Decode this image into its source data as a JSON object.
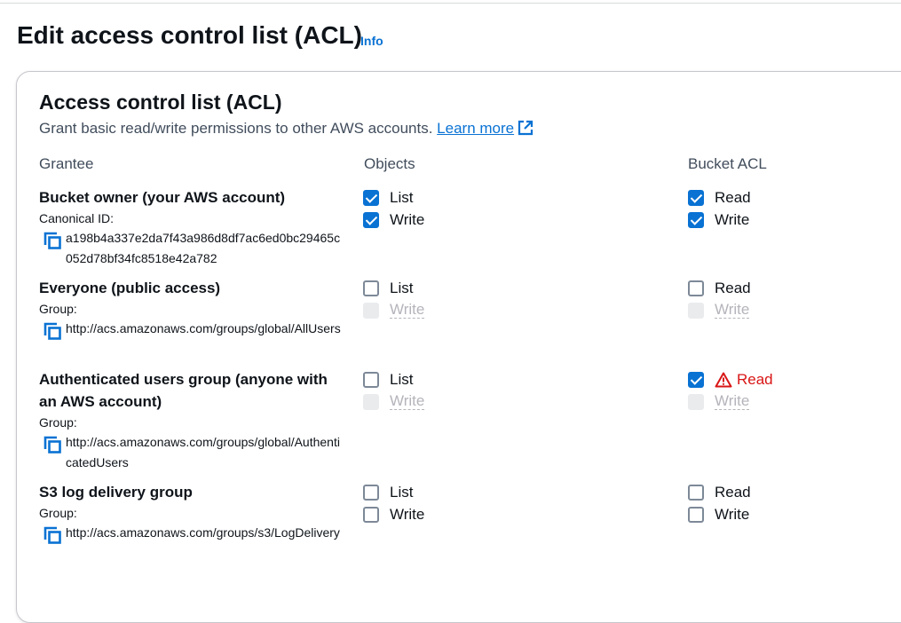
{
  "header": {
    "title": "Edit access control list (ACL)",
    "info": "Info"
  },
  "acl": {
    "title": "Access control list (ACL)",
    "description": "Grant basic read/write permissions to other AWS accounts. ",
    "learn_more": "Learn more",
    "columns": {
      "grantee": "Grantee",
      "objects": "Objects",
      "bucket": "Bucket ACL"
    }
  },
  "grantees": [
    {
      "name": "Bucket owner (your AWS account)",
      "id_label": "Canonical ID:",
      "id_value": "a198b4a337e2da7f43a986d8df7ac6ed0bc29465c052d78bf34fc8518e42a782",
      "objects": [
        {
          "label": "List",
          "state": "checked"
        },
        {
          "label": "Write",
          "state": "checked"
        }
      ],
      "bucket": [
        {
          "label": "Read",
          "state": "checked"
        },
        {
          "label": "Write",
          "state": "checked"
        }
      ]
    },
    {
      "name": "Everyone (public access)",
      "id_label": "Group:",
      "id_value": "http://acs.amazonaws.com/groups/global/AllUsers",
      "objects": [
        {
          "label": "List",
          "state": "unchecked"
        },
        {
          "label": "Write",
          "state": "disabled"
        }
      ],
      "bucket": [
        {
          "label": "Read",
          "state": "unchecked"
        },
        {
          "label": "Write",
          "state": "disabled"
        }
      ]
    },
    {
      "name": "Authenticated users group (anyone with an AWS account)",
      "id_label": "Group:",
      "id_value": "http://acs.amazonaws.com/groups/global/AuthenticatedUsers",
      "objects": [
        {
          "label": "List",
          "state": "unchecked"
        },
        {
          "label": "Write",
          "state": "disabled"
        }
      ],
      "bucket": [
        {
          "label": "Read",
          "state": "checked",
          "warning": true
        },
        {
          "label": "Write",
          "state": "disabled"
        }
      ]
    },
    {
      "name": "S3 log delivery group",
      "id_label": "Group:",
      "id_value": "http://acs.amazonaws.com/groups/s3/LogDelivery",
      "objects": [
        {
          "label": "List",
          "state": "unchecked"
        },
        {
          "label": "Write",
          "state": "unchecked"
        }
      ],
      "bucket": [
        {
          "label": "Read",
          "state": "unchecked"
        },
        {
          "label": "Write",
          "state": "unchecked"
        }
      ]
    }
  ],
  "colors": {
    "accent": "#0972d3",
    "warning": "#d91515",
    "disabled": "#b4b4bb"
  }
}
